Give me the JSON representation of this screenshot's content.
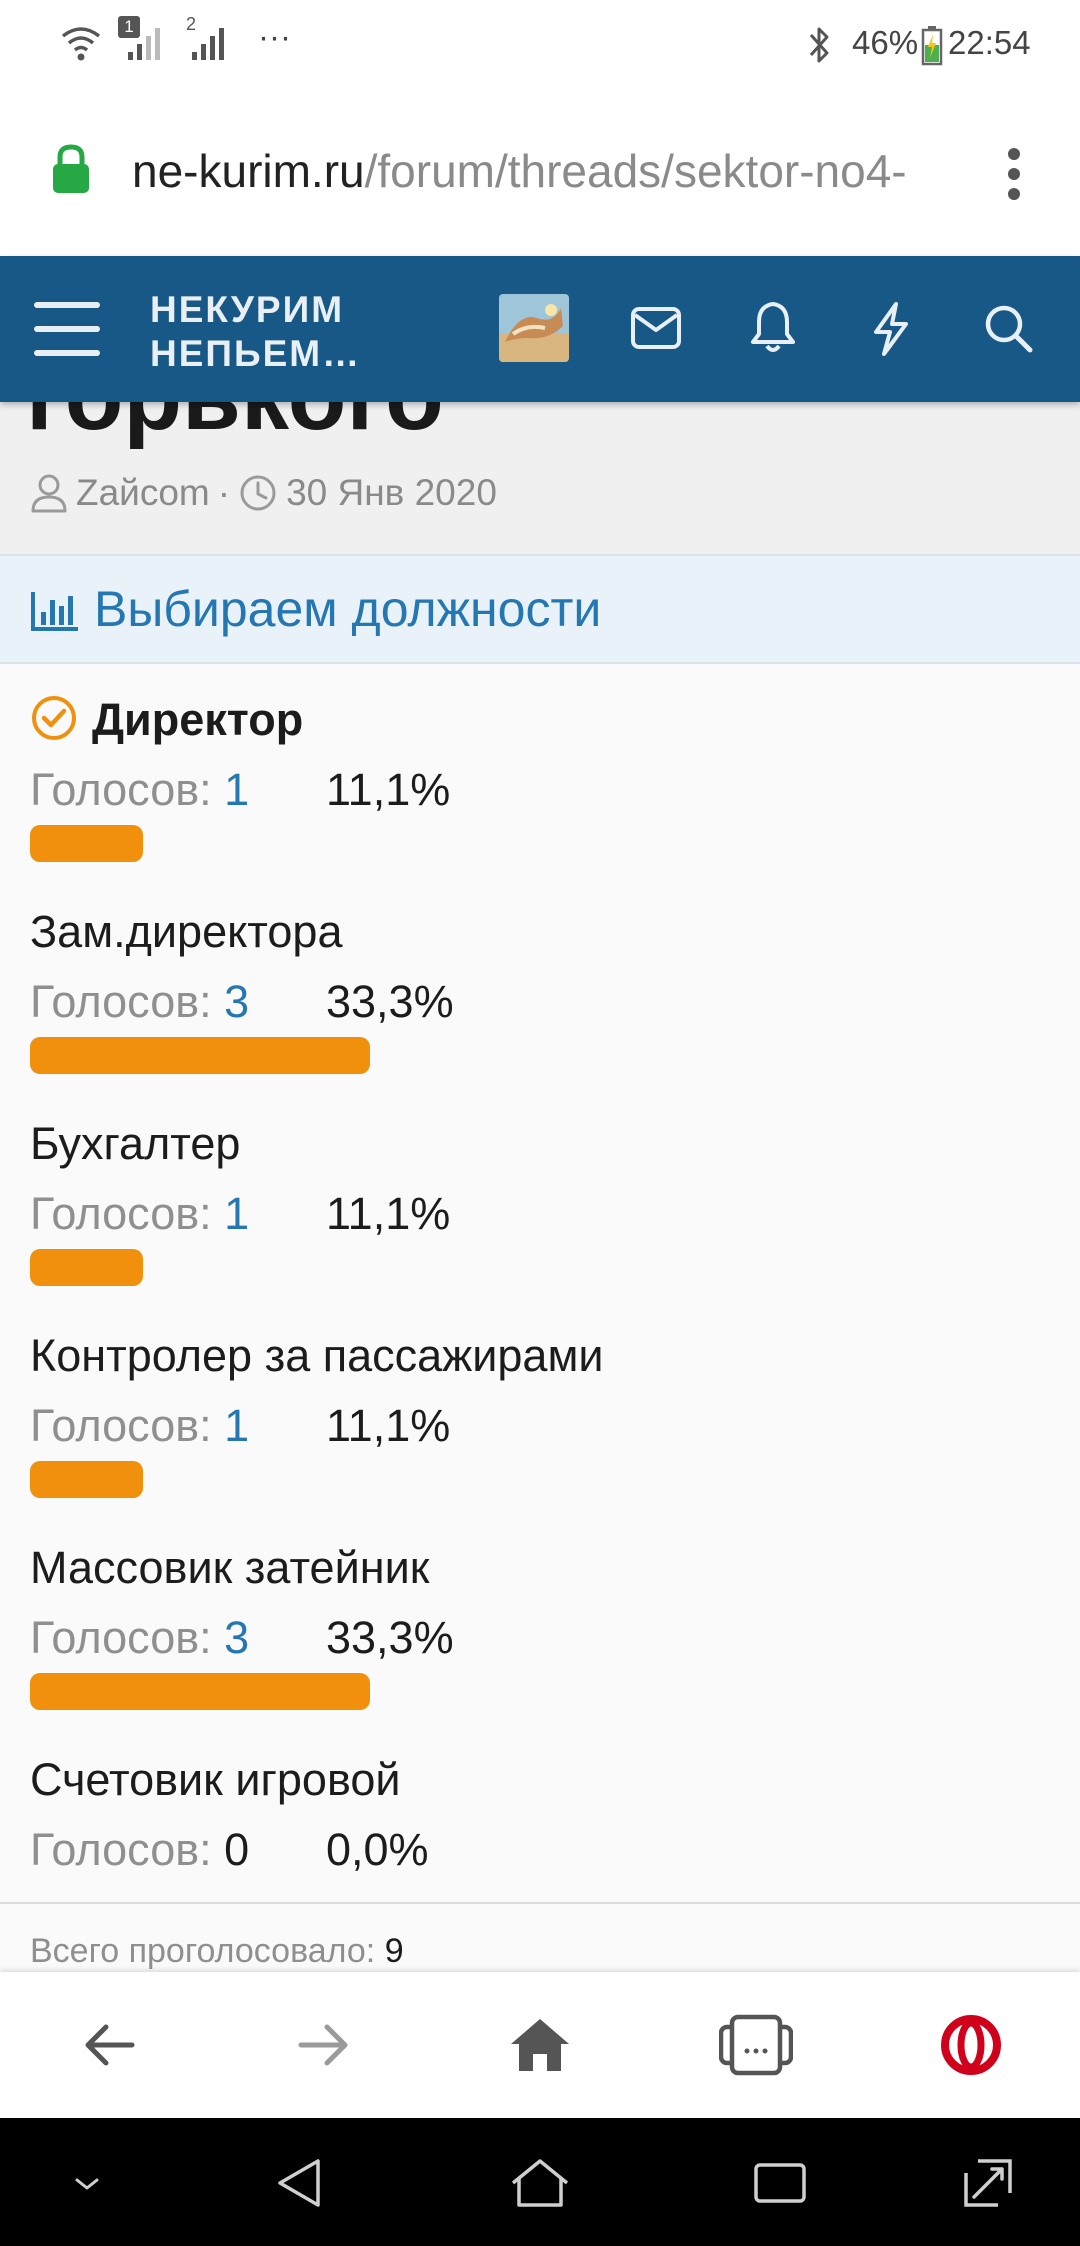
{
  "status_bar": {
    "sim1": "1",
    "sim2": "2",
    "more": "···",
    "battery": "46%",
    "time": "22:54"
  },
  "address_bar": {
    "domain": "ne-kurim.ru",
    "path": "/forum/threads/sektor-no4-"
  },
  "header": {
    "logo_line1": "НЕКУРИМ",
    "logo_line2": "НЕПЬЕМ…"
  },
  "thread": {
    "title_fragment": "горького",
    "author": "Zайcom",
    "separator": "·",
    "date": "30 Янв 2020"
  },
  "poll": {
    "title": "Выбираем должности",
    "votes_label": "Голосов:",
    "options": [
      {
        "label": "Директор",
        "votes": "1",
        "percent": "11,1%",
        "share": 0.111,
        "chosen": true
      },
      {
        "label": "Зам.директора",
        "votes": "3",
        "percent": "33,3%",
        "share": 0.333,
        "chosen": false
      },
      {
        "label": "Бухгалтер",
        "votes": "1",
        "percent": "11,1%",
        "share": 0.111,
        "chosen": false
      },
      {
        "label": "Контролер за пассажирами",
        "votes": "1",
        "percent": "11,1%",
        "share": 0.111,
        "chosen": false
      },
      {
        "label": "Массовик затейник",
        "votes": "3",
        "percent": "33,3%",
        "share": 0.333,
        "chosen": false
      },
      {
        "label": "Счетовик игровой",
        "votes": "0",
        "percent": "0,0%",
        "share": 0.0,
        "chosen": false
      }
    ],
    "total_label": "Всего проголосовало:",
    "total_value": "9"
  },
  "colors": {
    "header_bg": "#185886",
    "accent_blue": "#2577b1",
    "bar_orange": "#f0900c",
    "opera_red": "#d0021b"
  },
  "icons": {
    "status_bar": [
      "wifi-icon",
      "signal-icon",
      "bluetooth-icon",
      "battery-icon"
    ],
    "address_bar": [
      "lock-icon",
      "kebab-menu-icon"
    ],
    "header": [
      "hamburger-icon",
      "mail-icon",
      "bell-icon",
      "lightning-icon",
      "search-icon"
    ],
    "thread_meta": [
      "user-icon",
      "clock-icon"
    ],
    "poll": [
      "bar-chart-icon",
      "check-circle-icon"
    ],
    "browser_toolbar": [
      "back-arrow-icon",
      "forward-arrow-icon",
      "home-icon",
      "tabs-icon",
      "opera-icon"
    ],
    "android_nav": [
      "chevron-down-icon",
      "back-triangle-icon",
      "home-house-icon",
      "recents-icon",
      "rotate-icon"
    ]
  }
}
